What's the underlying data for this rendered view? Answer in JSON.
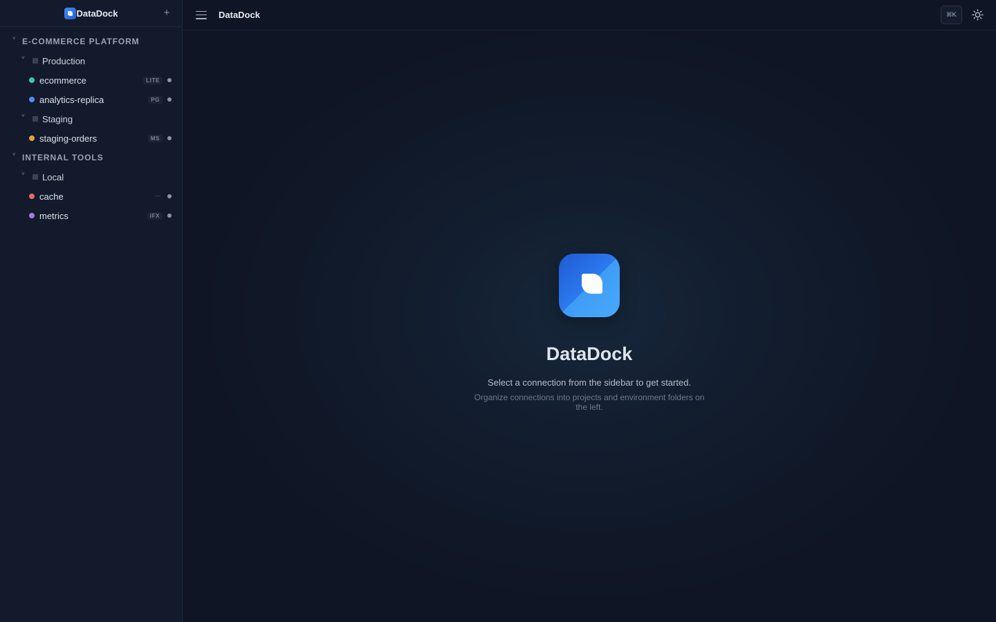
{
  "app": {
    "name": "DataDock"
  },
  "sidebar": {
    "brand": "DataDock",
    "add_label": "+",
    "projects": [
      {
        "name": "E-COMMERCE PLATFORM",
        "envs": [
          {
            "name": "Production",
            "connections": [
              {
                "name": "ecommerce",
                "badge": "LITE",
                "color": "#3ec9b0"
              },
              {
                "name": "analytics-replica",
                "badge": "PG",
                "color": "#4f8ef0"
              }
            ]
          },
          {
            "name": "Staging",
            "connections": [
              {
                "name": "staging-orders",
                "badge": "MS",
                "color": "#e0a33e"
              }
            ]
          }
        ]
      },
      {
        "name": "INTERNAL TOOLS",
        "envs": [
          {
            "name": "Local",
            "connections": [
              {
                "name": "cache",
                "badge": "—",
                "color": "#e06b6b"
              },
              {
                "name": "metrics",
                "badge": "IFX",
                "color": "#a779e0"
              }
            ]
          }
        ]
      }
    ]
  },
  "topbar": {
    "title": "DataDock",
    "shortcut": "⌘K"
  },
  "empty_state": {
    "title": "DataDock",
    "subtitle": "Select a connection from the sidebar to get started.",
    "note": "Organize connections into projects and environment folders on the left."
  }
}
